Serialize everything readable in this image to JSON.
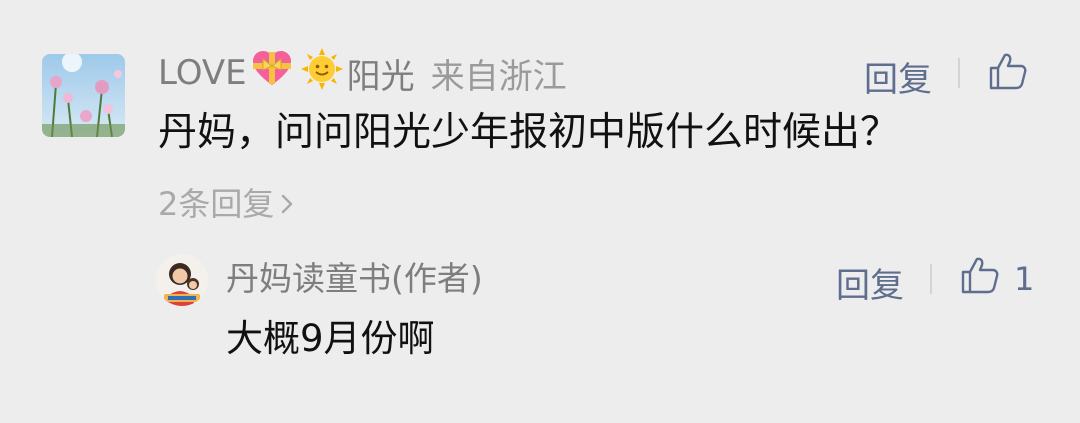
{
  "comment": {
    "author": "LOVE",
    "author_emoji_1": "heart-with-ribbon",
    "author_emoji_2": "sun-with-face",
    "author_suffix": "阳光",
    "location": "来自浙江",
    "text": "丹妈，问问阳光少年报初中版什么时候出？",
    "reply_label": "回复",
    "replies_link": "2条回复",
    "like_count": ""
  },
  "reply": {
    "author": "丹妈读童书(作者)",
    "text": "大概9月份啊",
    "reply_label": "回复",
    "like_count": "1"
  },
  "colors": {
    "background": "#ededed",
    "name": "#7e7e7e",
    "action": "#5f6e8e",
    "text": "#111111",
    "muted": "#a9a9a9"
  }
}
